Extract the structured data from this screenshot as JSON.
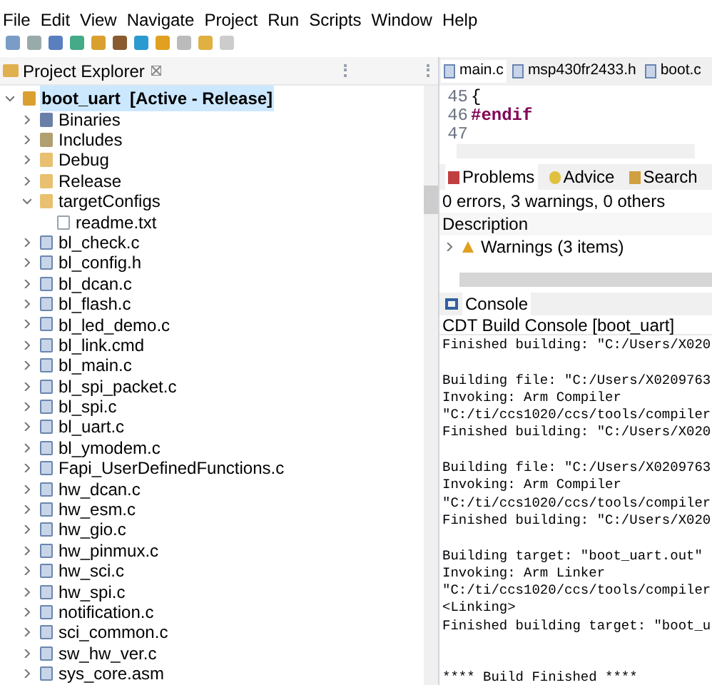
{
  "menu": [
    "File",
    "Edit",
    "View",
    "Navigate",
    "Project",
    "Run",
    "Scripts",
    "Window",
    "Help"
  ],
  "project_explorer": {
    "title": "Project Explorer",
    "tree": [
      {
        "label": "boot_uart",
        "suffix": "[Active - Release]",
        "kind": "project",
        "selected": true,
        "expanded": true,
        "children": [
          {
            "label": "Binaries",
            "kind": "binaries",
            "expanded": false
          },
          {
            "label": "Includes",
            "kind": "includes",
            "expanded": false
          },
          {
            "label": "Debug",
            "kind": "folder",
            "expanded": false
          },
          {
            "label": "Release",
            "kind": "folder",
            "expanded": false
          },
          {
            "label": "targetConfigs",
            "kind": "folder",
            "expanded": true,
            "children": [
              {
                "label": "readme.txt",
                "kind": "text"
              }
            ]
          },
          {
            "label": "bl_check.c",
            "kind": "source",
            "expanded": false
          },
          {
            "label": "bl_config.h",
            "kind": "source",
            "expanded": false
          },
          {
            "label": "bl_dcan.c",
            "kind": "source",
            "expanded": false
          },
          {
            "label": "bl_flash.c",
            "kind": "source",
            "expanded": false
          },
          {
            "label": "bl_led_demo.c",
            "kind": "source",
            "expanded": false
          },
          {
            "label": "bl_link.cmd",
            "kind": "source",
            "expanded": false
          },
          {
            "label": "bl_main.c",
            "kind": "source",
            "expanded": false
          },
          {
            "label": "bl_spi_packet.c",
            "kind": "source",
            "expanded": false
          },
          {
            "label": "bl_spi.c",
            "kind": "source",
            "expanded": false
          },
          {
            "label": "bl_uart.c",
            "kind": "source",
            "expanded": false
          },
          {
            "label": "bl_ymodem.c",
            "kind": "source",
            "expanded": false
          },
          {
            "label": "Fapi_UserDefinedFunctions.c",
            "kind": "source",
            "expanded": false
          },
          {
            "label": "hw_dcan.c",
            "kind": "source",
            "expanded": false
          },
          {
            "label": "hw_esm.c",
            "kind": "source",
            "expanded": false
          },
          {
            "label": "hw_gio.c",
            "kind": "source",
            "expanded": false
          },
          {
            "label": "hw_pinmux.c",
            "kind": "source",
            "expanded": false
          },
          {
            "label": "hw_sci.c",
            "kind": "source",
            "expanded": false
          },
          {
            "label": "hw_spi.c",
            "kind": "source",
            "expanded": false
          },
          {
            "label": "notification.c",
            "kind": "source",
            "expanded": false
          },
          {
            "label": "sci_common.c",
            "kind": "source",
            "expanded": false
          },
          {
            "label": "sw_hw_ver.c",
            "kind": "source",
            "expanded": false
          },
          {
            "label": "sys_core.asm",
            "kind": "source",
            "expanded": false
          }
        ]
      }
    ]
  },
  "editor": {
    "tabs": [
      {
        "label": "main.c",
        "selected": true
      },
      {
        "label": "msp430fr2433.h",
        "selected": false
      },
      {
        "label": "boot.c",
        "selected": false
      }
    ],
    "lines": [
      {
        "number": "45",
        "code": "{",
        "kind": "plain"
      },
      {
        "number": "46",
        "code": "#endif",
        "kind": "directive"
      },
      {
        "number": "47",
        "kind": "plain"
      }
    ]
  },
  "problems": {
    "tabs": [
      {
        "label": "Problems",
        "selected": true
      },
      {
        "label": "Advice",
        "selected": false
      },
      {
        "label": "Search",
        "selected": false
      }
    ],
    "summary": "0 errors, 3 warnings, 0 others",
    "column": "Description",
    "groups": [
      {
        "label": "Warnings (3 items)",
        "expanded": false
      }
    ]
  },
  "console": {
    "title": "Console",
    "subtitle": "CDT Build Console [boot_uart]",
    "lines": [
      {
        "text": "Finished building: \"C:/Users/X020",
        "kind": "output"
      },
      {
        "text": "Building file: \"C:/Users/X0209763",
        "kind": "step"
      },
      {
        "text": "Invoking: Arm Compiler",
        "kind": "output"
      },
      {
        "text": "\"C:/ti/ccs1020/ccs/tools/compiler",
        "kind": "output"
      },
      {
        "text": "Finished building: \"C:/Users/X020",
        "kind": "output"
      },
      {
        "text": "Building file: \"C:/Users/X0209763",
        "kind": "step"
      },
      {
        "text": "Invoking: Arm Compiler",
        "kind": "output"
      },
      {
        "text": "\"C:/ti/ccs1020/ccs/tools/compiler",
        "kind": "output"
      },
      {
        "text": "Finished building: \"C:/Users/X020",
        "kind": "output"
      },
      {
        "text": "Building target: \"boot_uart.out\"",
        "kind": "step"
      },
      {
        "text": "Invoking: Arm Linker",
        "kind": "output"
      },
      {
        "text": "\"C:/ti/ccs1020/ccs/tools/compiler",
        "kind": "output"
      },
      {
        "text": "<Linking>",
        "kind": "output"
      },
      {
        "text": "Finished building target: \"boot_u",
        "kind": "output"
      },
      {
        "text": "**** Build Finished ****",
        "kind": "summary"
      }
    ]
  }
}
